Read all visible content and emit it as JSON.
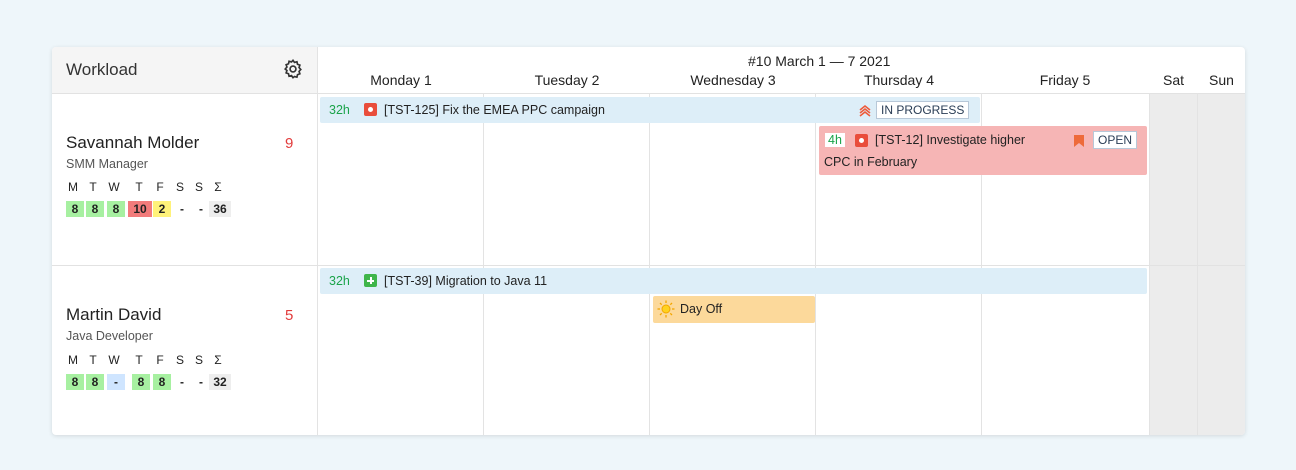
{
  "header": {
    "title": "Workload",
    "week": "#10 March 1 — 7 2021",
    "days": [
      "Monday 1",
      "Tuesday 2",
      "Wednesday 3",
      "Thursday 4",
      "Friday 5",
      "Sat",
      "Sun"
    ]
  },
  "weekday_letters": [
    "M",
    "T",
    "W",
    "T",
    "F",
    "S",
    "S",
    "Σ"
  ],
  "people": [
    {
      "name": "Savannah Molder",
      "role": "SMM Manager",
      "count": "9",
      "hours": [
        "8",
        "8",
        "8",
        "10",
        "2",
        "-",
        "-",
        "36"
      ],
      "tasks": [
        {
          "hours": "32h",
          "id_title": "[TST-125] Fix the EMEA PPC campaign",
          "status": "IN PROGRESS"
        },
        {
          "hours": "4h",
          "id_title_line1": "[TST-12] Investigate higher",
          "id_title_line2": "CPC in February",
          "status": "OPEN"
        }
      ]
    },
    {
      "name": "Martin David",
      "role": "Java Developer",
      "count": "5",
      "hours": [
        "8",
        "8",
        "-",
        "8",
        "8",
        "-",
        "-",
        "32"
      ],
      "tasks": [
        {
          "hours": "32h",
          "id_title": "[TST-39] Migration to Java 11"
        }
      ],
      "day_off": "Day Off"
    }
  ],
  "colors": {
    "hours_green": "#1aa34a",
    "count_red": "#e23b3b",
    "task_bar": "#ddeef8",
    "overdue_bar": "#f6b5b5",
    "day_off_bar": "#fcd99b"
  }
}
